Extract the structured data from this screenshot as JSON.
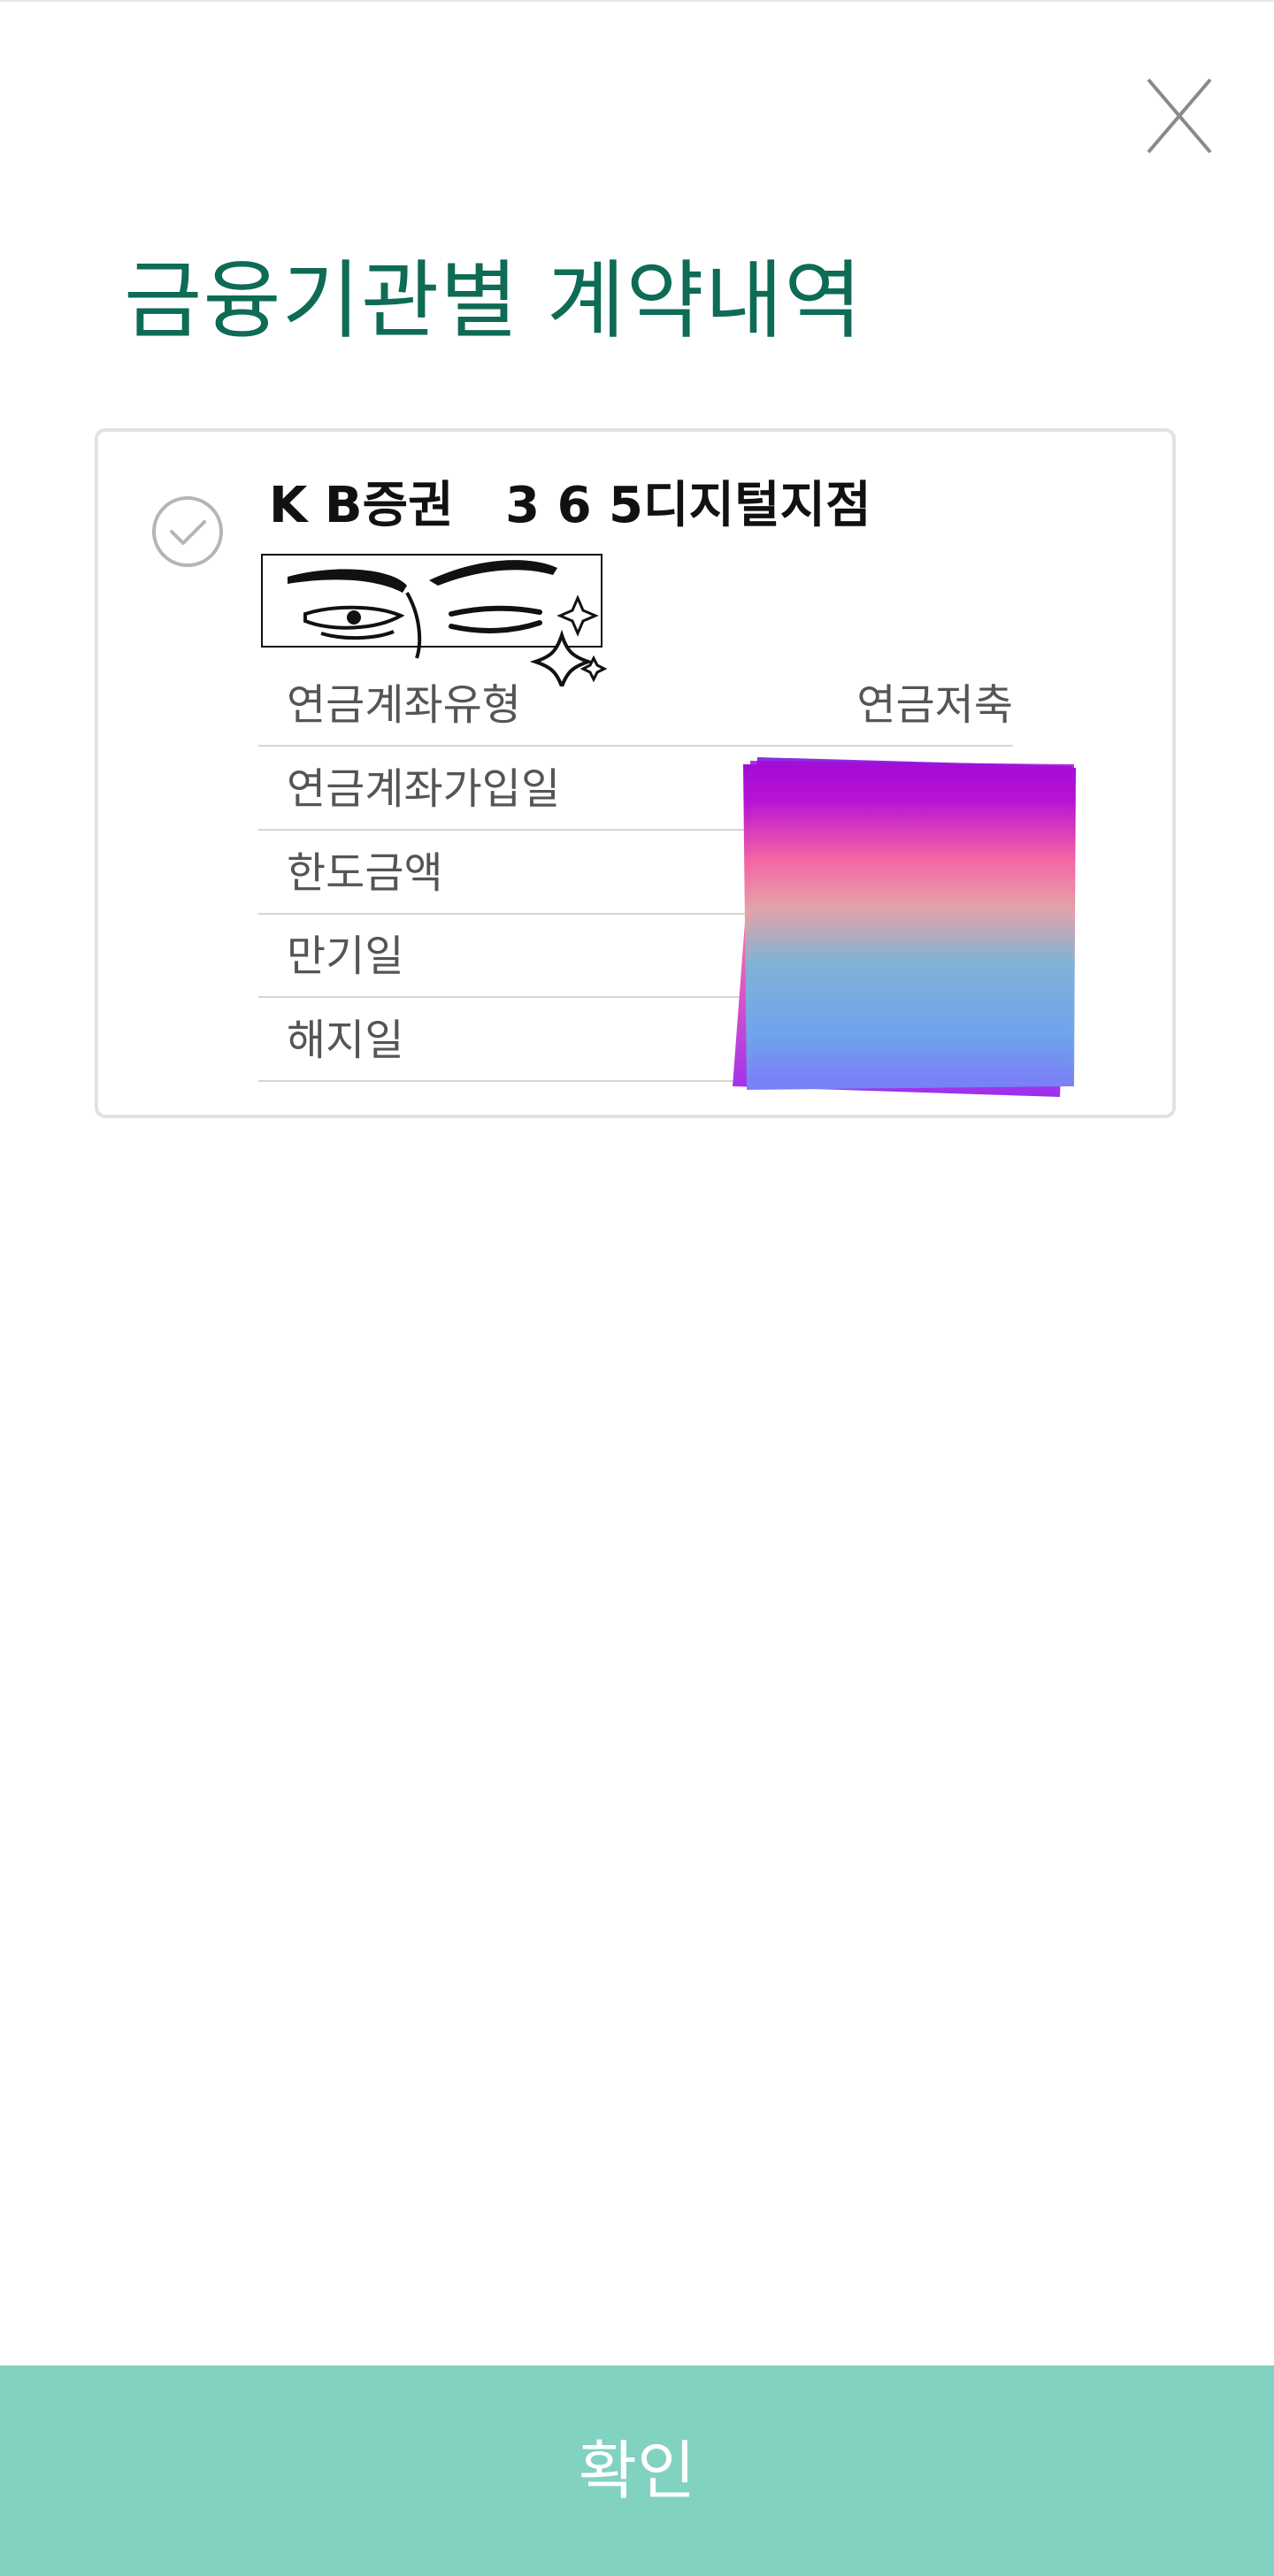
{
  "header": {
    "title": "금융기관별 계약내역"
  },
  "contract": {
    "institution": "K B증권   3 6 5디지털지점",
    "rows": [
      {
        "label": "연금계좌유형",
        "value": "연금저축"
      },
      {
        "label": "연금계좌가입일",
        "value": ""
      },
      {
        "label": "한도금액",
        "value": ""
      },
      {
        "label": "만기일",
        "value": ""
      },
      {
        "label": "해지일",
        "value": ""
      }
    ]
  },
  "footer": {
    "confirm_label": "확인"
  },
  "icons": {
    "close": "close-icon",
    "check": "check-circle-icon",
    "sticker": "eyes-sticker-icon"
  },
  "colors": {
    "title": "#0e6b55",
    "confirm_bg": "#82d2c1",
    "card_border": "#e2e2e2"
  }
}
